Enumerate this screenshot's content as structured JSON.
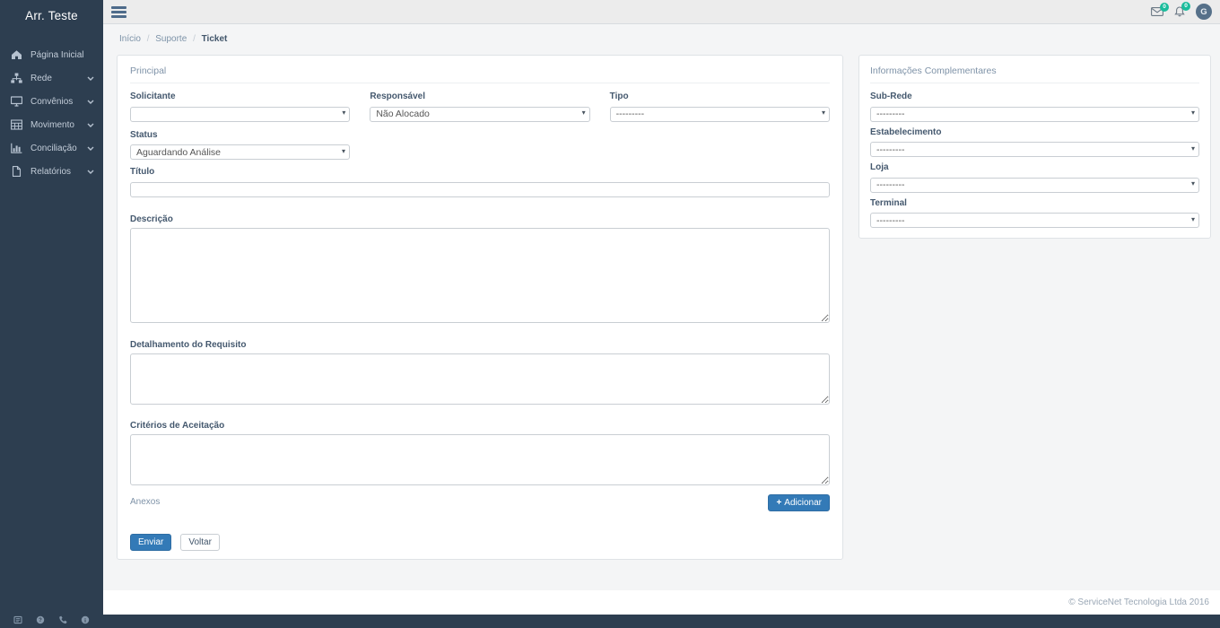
{
  "sidebar": {
    "brand": "Arr. Teste",
    "items": [
      {
        "label": "Página Inicial",
        "icon": "home-icon",
        "expandable": false
      },
      {
        "label": "Rede",
        "icon": "sitemap-icon",
        "expandable": true
      },
      {
        "label": "Convênios",
        "icon": "desktop-icon",
        "expandable": true
      },
      {
        "label": "Movimento",
        "icon": "table-icon",
        "expandable": true
      },
      {
        "label": "Conciliação",
        "icon": "bar-chart-icon",
        "expandable": true
      },
      {
        "label": "Relatórios",
        "icon": "file-icon",
        "expandable": true
      }
    ],
    "footer_icons": [
      "newspaper-icon",
      "help-icon",
      "phone-icon",
      "info-icon"
    ]
  },
  "topbar": {
    "messages_badge": "0",
    "notifications_badge": "0",
    "avatar_initial": "G"
  },
  "breadcrumb": {
    "items": [
      "Início",
      "Suporte"
    ],
    "active": "Ticket"
  },
  "form": {
    "section_title": "Principal",
    "solicitante": {
      "label": "Solicitante",
      "value": ""
    },
    "responsavel": {
      "label": "Responsável",
      "value": "Não Alocado"
    },
    "tipo": {
      "label": "Tipo",
      "value": "---------"
    },
    "status": {
      "label": "Status",
      "value": "Aguardando Análise"
    },
    "titulo": {
      "label": "Título",
      "value": ""
    },
    "descricao": {
      "label": "Descrição",
      "value": ""
    },
    "detalhamento": {
      "label": "Detalhamento do Requisito",
      "value": ""
    },
    "criterios": {
      "label": "Critérios de Aceitação",
      "value": ""
    },
    "anexos": {
      "label": "Anexos",
      "add_button": "Adicionar",
      "add_icon": "+"
    },
    "submit_label": "Enviar",
    "back_label": "Voltar"
  },
  "side_panel": {
    "section_title": "Informações Complementares",
    "sub_rede": {
      "label": "Sub-Rede",
      "value": "---------"
    },
    "estabelecimento": {
      "label": "Estabelecimento",
      "value": "---------"
    },
    "loja": {
      "label": "Loja",
      "value": "---------"
    },
    "terminal": {
      "label": "Terminal",
      "value": "---------"
    }
  },
  "footer": {
    "copyright": "© ServiceNet Tecnologia Ltda 2016"
  },
  "colors": {
    "sidebar_bg": "#2d3e50",
    "primary_button": "#337ab7",
    "badge_green": "#1abc9c",
    "topbar_bg": "#ececec",
    "content_bg": "#f4f5f6"
  }
}
